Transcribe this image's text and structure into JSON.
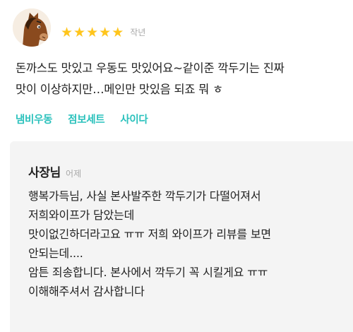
{
  "review": {
    "avatar_icon": "horse-avatar-icon",
    "rating": 5,
    "star_glyph": "★",
    "time": "작년",
    "text": "돈까스도 맛있고 우동도 맛있어요~같이준 깍두기는 진짜\n맛이 이상하지만…메인만 맛있음 되죠 뭐 ㅎ",
    "menus": [
      "냄비우동",
      "점보세트",
      "사이다"
    ]
  },
  "reply": {
    "owner": "사장님",
    "time": "어제",
    "text": "행복가득님, 사실 본사발주한 깍두기가 다떨어져서\n저희와이프가 담았는데\n맛이없긴하더라고요 ㅠㅠ 저희 와이프가 리뷰를 보면\n안되는데....\n암튼 죄송합니다. 본사에서 깍두기 꼭 시킬게요 ㅠㅠ\n이해해주셔서 감사합니다"
  },
  "colors": {
    "star": "#ffc51c",
    "menu_tag": "#2ac1bc",
    "reply_bg": "#f4f4f4",
    "muted": "#a8a8a8"
  }
}
